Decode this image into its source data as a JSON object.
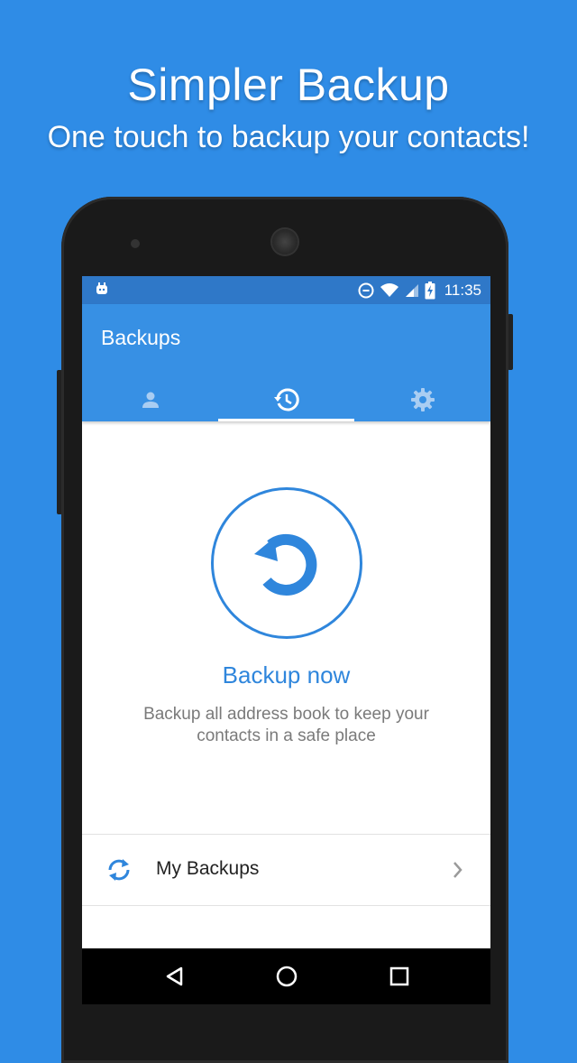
{
  "promo": {
    "title": "Simpler Backup",
    "subtitle": "One touch to backup your contacts!"
  },
  "status_bar": {
    "time": "11:35",
    "icons": [
      "android-app-icon",
      "data-saver-icon",
      "wifi-icon",
      "signal-icon",
      "battery-charging-icon"
    ]
  },
  "app_bar": {
    "title": "Backups",
    "tabs": [
      {
        "name": "tab-contacts",
        "icon": "person-icon",
        "selected": false
      },
      {
        "name": "tab-backups",
        "icon": "history-icon",
        "selected": true
      },
      {
        "name": "tab-settings",
        "icon": "gear-icon",
        "selected": false
      }
    ]
  },
  "main": {
    "backup_button_icon": "restore-icon",
    "backup_now_label": "Backup now",
    "description": "Backup all address book to keep your contacts in a safe place",
    "list_items": [
      {
        "label": "My Backups",
        "icon": "sync-icon",
        "trailing_icon": "chevron-right-icon"
      }
    ]
  },
  "nav_bar": {
    "buttons": [
      "back-icon",
      "home-icon",
      "recents-icon"
    ]
  },
  "colors": {
    "background": "#2f8ce6",
    "status_bar": "#2f78c8",
    "app_bar": "#3790e4",
    "accent": "#2f86dc"
  }
}
